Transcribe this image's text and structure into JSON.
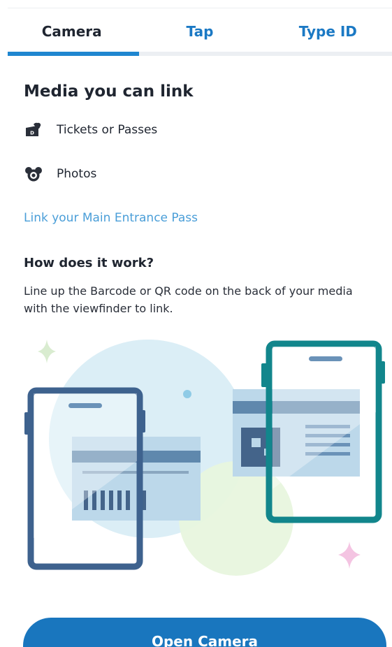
{
  "tabs": [
    {
      "label": "Camera",
      "active": true
    },
    {
      "label": "Tap",
      "active": false
    },
    {
      "label": "Type ID",
      "active": false
    }
  ],
  "media_section": {
    "title": "Media you can link",
    "items": [
      {
        "icon": "ticket-pass-icon",
        "label": "Tickets or Passes"
      },
      {
        "icon": "mickey-camera-icon",
        "label": "Photos"
      }
    ]
  },
  "link_main_entrance_pass": "Link your Main Entrance Pass",
  "how_it_works": {
    "title": "How does it work?",
    "body": "Line up the Barcode or QR code on the back of your media with the viewfinder to link."
  },
  "open_camera_button": "Open Camera",
  "colors": {
    "accent_blue": "#1b79c4",
    "link_blue": "#4a9ed8",
    "teal": "#12868c",
    "text_dark": "#1f2530"
  }
}
